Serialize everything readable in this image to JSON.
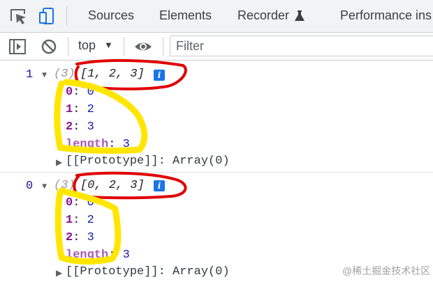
{
  "tabs": {
    "sources": "Sources",
    "elements": "Elements",
    "recorder": "Recorder",
    "performance": "Performance ins"
  },
  "toolbar": {
    "context": "top",
    "filter_placeholder": "Filter"
  },
  "messages": [
    {
      "log_value": "1",
      "length_prefix": "(3)",
      "array_preview": "[1, 2, 3]",
      "props": [
        {
          "key": "0",
          "value": "0"
        },
        {
          "key": "1",
          "value": "2"
        },
        {
          "key": "2",
          "value": "3"
        },
        {
          "key": "length",
          "value": "3"
        }
      ],
      "prototype_key": "[[Prototype]]",
      "prototype_value": "Array(0)"
    },
    {
      "log_value": "0",
      "length_prefix": "(3)",
      "array_preview": "[0, 2, 3]",
      "props": [
        {
          "key": "0",
          "value": "0"
        },
        {
          "key": "1",
          "value": "2"
        },
        {
          "key": "2",
          "value": "3"
        },
        {
          "key": "length",
          "value": "3"
        }
      ],
      "prototype_key": "[[Prototype]]",
      "prototype_value": "Array(0)"
    }
  ],
  "info_badge": "i",
  "watermark": "@稀土掘金技术社区",
  "icons": [
    "inspect-icon",
    "device-toolbar-icon",
    "flask-icon",
    "sidebar-toggle-icon",
    "clear-console-icon",
    "dropdown-caret-icon",
    "eye-icon",
    "expand-triangle-icon",
    "info-icon"
  ],
  "colors": {
    "annotation_red": "#e00000",
    "annotation_yellow": "#ffe600",
    "key_purple": "#881391",
    "number_blue": "#1a1aa6",
    "info_blue": "#1a73e8"
  }
}
